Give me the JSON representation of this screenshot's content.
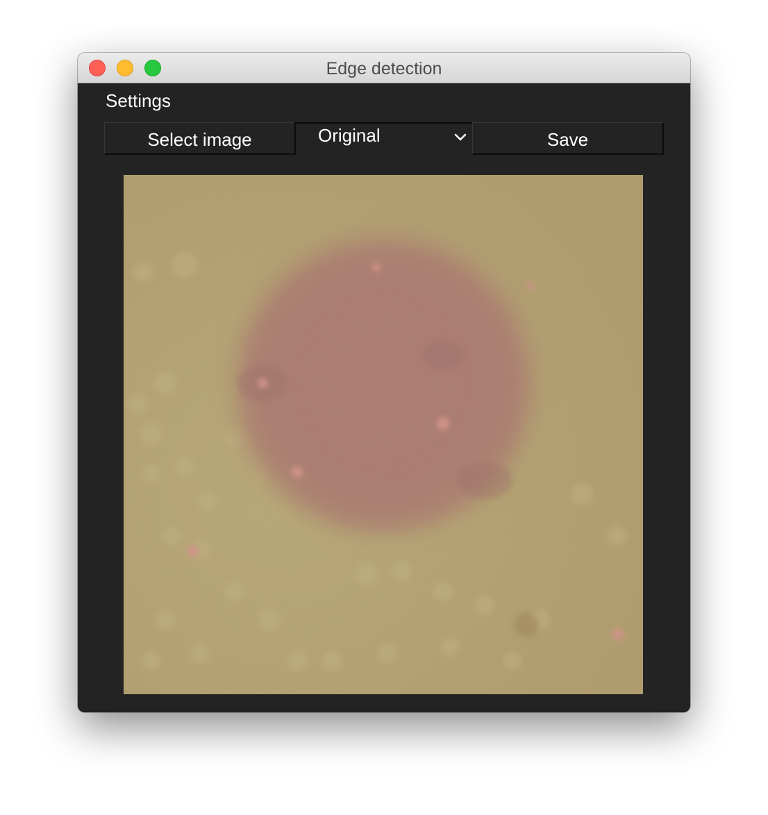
{
  "window": {
    "title": "Edge detection"
  },
  "menu": {
    "settings_label": "Settings"
  },
  "toolbar": {
    "select_image_label": "Select image",
    "mode_dropdown_value": "Original",
    "save_label": "Save"
  },
  "colors": {
    "content_background": "#232323",
    "image_base": "#ae9a6c",
    "cell": "#a8766e"
  },
  "icons": {
    "close": "close-button",
    "minimize": "minimize-button",
    "maximize": "zoom-button",
    "dropdown": "chevron-down-icon"
  }
}
